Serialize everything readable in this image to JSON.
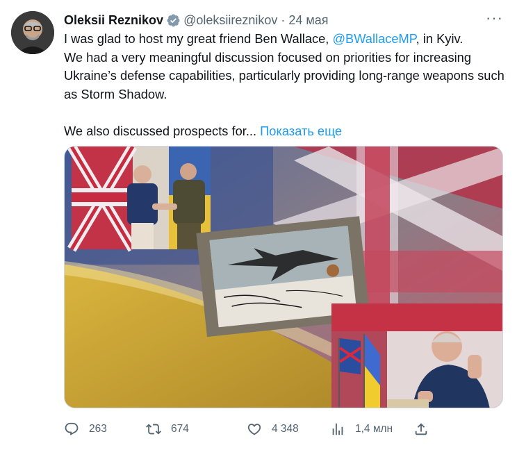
{
  "author": {
    "name": "Oleksii Reznikov",
    "handle": "@oleksiireznikov",
    "separator": "·",
    "date": "24 мая"
  },
  "more_label": "···",
  "text": {
    "line1_before": "I was glad to host my great friend Ben Wallace, ",
    "mention": "@BWallaceMP",
    "line1_after": ", in Kyiv.\nWe had a very meaningful discussion focused on priorities for increasing Ukraine’s defense capabilities, particularly providing long-range weapons such as Storm Shadow.",
    "line2": "We also discussed prospects for... ",
    "show_more": "Показать еще"
  },
  "stats": {
    "replies": "263",
    "retweets": "674",
    "likes": "4 348",
    "views": "1,4 млн"
  },
  "icons": {
    "verified": "verified-badge-icon",
    "reply": "reply-icon",
    "retweet": "retweet-icon",
    "like": "heart-icon",
    "views": "views-icon",
    "share": "share-icon"
  },
  "colors": {
    "accent": "#1d9bf0",
    "text": "#0f1419",
    "muted": "#536471"
  }
}
